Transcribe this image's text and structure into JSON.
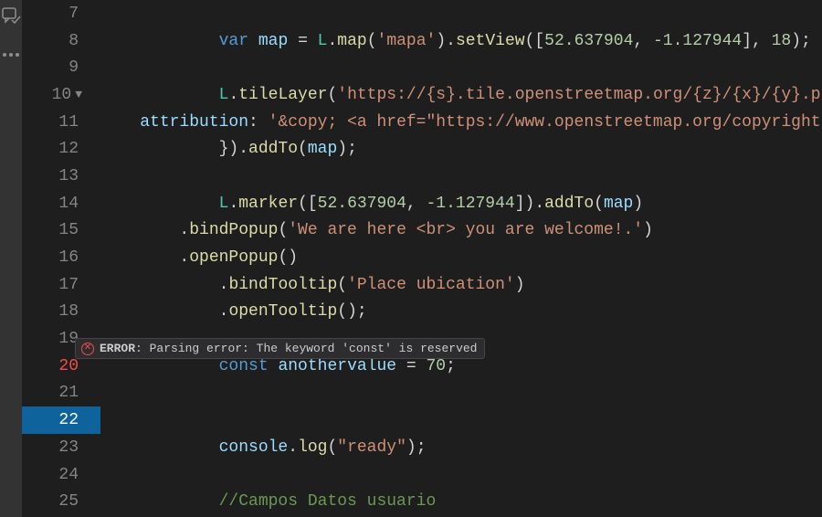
{
  "gutter": {
    "start": 7,
    "end": 25,
    "errorLines": [
      20
    ],
    "activeLine": 22,
    "foldLine": 10
  },
  "error": {
    "label": "ERROR",
    "message": "Parsing error: The keyword 'const' is reserved"
  },
  "code": {
    "7": [],
    "8": [
      {
        "t": "white",
        "v": "            "
      },
      {
        "t": "keyword",
        "v": "var"
      },
      {
        "t": "white",
        "v": " "
      },
      {
        "t": "var",
        "v": "map"
      },
      {
        "t": "white",
        "v": " "
      },
      {
        "t": "punct",
        "v": "= "
      },
      {
        "t": "type",
        "v": "L"
      },
      {
        "t": "punct",
        "v": "."
      },
      {
        "t": "func",
        "v": "map"
      },
      {
        "t": "punct",
        "v": "("
      },
      {
        "t": "string",
        "v": "'mapa'"
      },
      {
        "t": "punct",
        "v": ")."
      },
      {
        "t": "func",
        "v": "setView"
      },
      {
        "t": "punct",
        "v": "(["
      },
      {
        "t": "number",
        "v": "52.637904"
      },
      {
        "t": "punct",
        "v": ", "
      },
      {
        "t": "number",
        "v": "-1.127944"
      },
      {
        "t": "punct",
        "v": "], "
      },
      {
        "t": "number",
        "v": "18"
      },
      {
        "t": "punct",
        "v": ");"
      }
    ],
    "9": [],
    "10": [
      {
        "t": "white",
        "v": "            "
      },
      {
        "t": "type",
        "v": "L"
      },
      {
        "t": "punct",
        "v": "."
      },
      {
        "t": "func",
        "v": "tileLayer"
      },
      {
        "t": "punct",
        "v": "("
      },
      {
        "t": "string",
        "v": "'https://{s}.tile.openstreetmap.org/{z}/{x}/{y}.png'"
      },
      {
        "t": "punct",
        "v": ", {"
      }
    ],
    "11": [
      {
        "t": "white",
        "v": "    "
      },
      {
        "t": "var",
        "v": "attribution"
      },
      {
        "t": "punct",
        "v": ": "
      },
      {
        "t": "string",
        "v": "'&copy; <a href=\"https://www.openstreetmap.org/copyright\""
      }
    ],
    "12": [
      {
        "t": "white",
        "v": "            })."
      },
      {
        "t": "func",
        "v": "addTo"
      },
      {
        "t": "punct",
        "v": "("
      },
      {
        "t": "var",
        "v": "map"
      },
      {
        "t": "punct",
        "v": ");"
      }
    ],
    "13": [],
    "14": [
      {
        "t": "white",
        "v": "            "
      },
      {
        "t": "type",
        "v": "L"
      },
      {
        "t": "punct",
        "v": "."
      },
      {
        "t": "func",
        "v": "marker"
      },
      {
        "t": "punct",
        "v": "(["
      },
      {
        "t": "number",
        "v": "52.637904"
      },
      {
        "t": "punct",
        "v": ", "
      },
      {
        "t": "number",
        "v": "-1.127944"
      },
      {
        "t": "punct",
        "v": "])."
      },
      {
        "t": "func",
        "v": "addTo"
      },
      {
        "t": "punct",
        "v": "("
      },
      {
        "t": "var",
        "v": "map"
      },
      {
        "t": "punct",
        "v": ")"
      }
    ],
    "15": [
      {
        "t": "white",
        "v": "        ."
      },
      {
        "t": "func",
        "v": "bindPopup"
      },
      {
        "t": "punct",
        "v": "("
      },
      {
        "t": "string",
        "v": "'We are here <br> you are welcome!.'"
      },
      {
        "t": "punct",
        "v": ")"
      }
    ],
    "16": [
      {
        "t": "white",
        "v": "        ."
      },
      {
        "t": "func",
        "v": "openPopup"
      },
      {
        "t": "punct",
        "v": "()"
      }
    ],
    "17": [
      {
        "t": "white",
        "v": "            ."
      },
      {
        "t": "func",
        "v": "bindTooltip"
      },
      {
        "t": "punct",
        "v": "("
      },
      {
        "t": "string",
        "v": "'Place ubication'"
      },
      {
        "t": "punct",
        "v": ")"
      }
    ],
    "18": [
      {
        "t": "white",
        "v": "            ."
      },
      {
        "t": "func",
        "v": "openTooltip"
      },
      {
        "t": "punct",
        "v": "();"
      }
    ],
    "19": [],
    "20": [
      {
        "t": "white",
        "v": "            "
      },
      {
        "t": "keyword",
        "v": "const"
      },
      {
        "t": "white",
        "v": " "
      },
      {
        "t": "var",
        "v": "anothervalue"
      },
      {
        "t": "white",
        "v": " "
      },
      {
        "t": "punct",
        "v": "= "
      },
      {
        "t": "number",
        "v": "70"
      },
      {
        "t": "punct",
        "v": ";"
      }
    ],
    "21": [],
    "22": [],
    "23": [
      {
        "t": "white",
        "v": "            "
      },
      {
        "t": "var",
        "v": "console"
      },
      {
        "t": "punct",
        "v": "."
      },
      {
        "t": "func",
        "v": "log"
      },
      {
        "t": "punct",
        "v": "("
      },
      {
        "t": "string",
        "v": "\"ready\""
      },
      {
        "t": "punct",
        "v": ");"
      }
    ],
    "24": [],
    "25": [
      {
        "t": "white",
        "v": "            "
      },
      {
        "t": "comment",
        "v": "//Campos Datos usuario"
      }
    ]
  }
}
